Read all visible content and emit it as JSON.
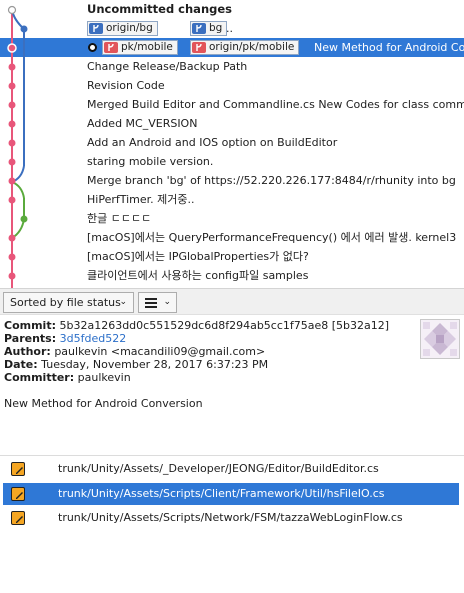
{
  "commit_list": {
    "rows": [
      {
        "message": "Uncommitted changes"
      },
      {
        "refs": [
          {
            "label": "origin/bg",
            "kind": "remote"
          },
          {
            "label": "bg",
            "kind": "remote"
          }
        ],
        "after": ".."
      },
      {
        "refs": [
          {
            "label": "pk/mobile",
            "kind": "local"
          },
          {
            "label": "origin/pk/mobile",
            "kind": "local"
          }
        ],
        "message": "New Method for Android Conversion"
      },
      {
        "message": "Change Release/Backup Path"
      },
      {
        "message": "Revision Code"
      },
      {
        "message": "Merged Build Editor and Commandline.cs New Codes for class command"
      },
      {
        "message": "Added MC_VERSION"
      },
      {
        "message": "Add an Android and IOS option on BuildEditor"
      },
      {
        "message": "staring mobile version."
      },
      {
        "message": "Merge branch 'bg' of https://52.220.226.177:8484/r/rhunity into bg"
      },
      {
        "message": "HiPerfTimer. 제거중.."
      },
      {
        "message": "한글 ㄷㄷㄷㄷ"
      },
      {
        "message": "[macOS]에서는   QueryPerformanceFrequency() 에서 에러 발생.  kernel3"
      },
      {
        "message": "[macOS]에서는 IPGlobalProperties가 없다?"
      },
      {
        "message": "클라이언트에서 사용하는 config파일 samples"
      }
    ],
    "colors": {
      "selected": "#2f78d6",
      "graph_pink": "#e8567a",
      "graph_blue": "#3b6fbf",
      "graph_green": "#5aaa3c"
    }
  },
  "toolbar": {
    "sort_label": "Sorted by file status",
    "sort_chevron": "⌄",
    "view_chevron": "⌄"
  },
  "details": {
    "commit_label": "Commit:",
    "commit_value": "5b32a1263dd0c551529dc6d8f294ab5cc1f75ae8 [5b32a12]",
    "parents_label": "Parents:",
    "parents_value": "3d5fded522",
    "author_label": "Author:",
    "author_value": "paulkevin <macandili09@gmail.com>",
    "date_label": "Date:",
    "date_value": "Tuesday, November 28, 2017 6:37:23 PM",
    "committer_label": "Committer:",
    "committer_value": "paulkevin",
    "message": "New Method for Android Conversion"
  },
  "files": [
    {
      "path": "trunk/Unity/Assets/_Developer/JEONG/Editor/BuildEditor.cs",
      "selected": false
    },
    {
      "path": "trunk/Unity/Assets/Scripts/Client/Framework/Util/hsFileIO.cs",
      "selected": true
    },
    {
      "path": "trunk/Unity/Assets/Scripts/Network/FSM/tazzaWebLoginFlow.cs",
      "selected": false
    }
  ]
}
